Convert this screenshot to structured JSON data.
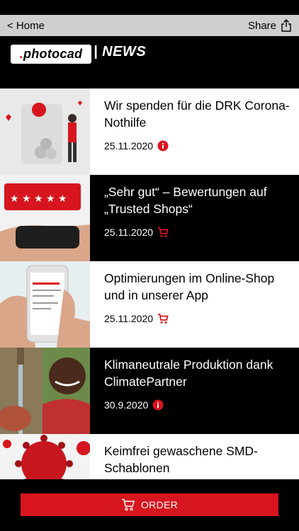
{
  "nav": {
    "back_label": "< Home",
    "share_label": "Share"
  },
  "header": {
    "logo_text_dot": ".",
    "logo_text": "photocad",
    "title": "| NEWS"
  },
  "colors": {
    "accent": "#d7151e",
    "nav_bg": "#cfcfcf"
  },
  "news": [
    {
      "title": "Wir spenden für die DRK Corona-Nothilfe",
      "date": "25.11.2020",
      "icon": "info-icon",
      "theme": "light"
    },
    {
      "title": "„Sehr gut“ – Bewertungen auf „Trusted Shops“",
      "date": "25.11.2020",
      "icon": "cart-icon",
      "theme": "dark"
    },
    {
      "title": "Optimierungen im Online-Shop und in unserer App",
      "date": "25.11.2020",
      "icon": "cart-icon",
      "theme": "light"
    },
    {
      "title": "Klimaneutrale Produktion dank ClimatePartner",
      "date": "30.9.2020",
      "icon": "info-icon",
      "theme": "dark"
    },
    {
      "title": "Keimfrei gewaschene SMD-Schablonen",
      "date": "",
      "icon": "",
      "theme": "light"
    }
  ],
  "footer": {
    "order_label": "ORDER"
  }
}
